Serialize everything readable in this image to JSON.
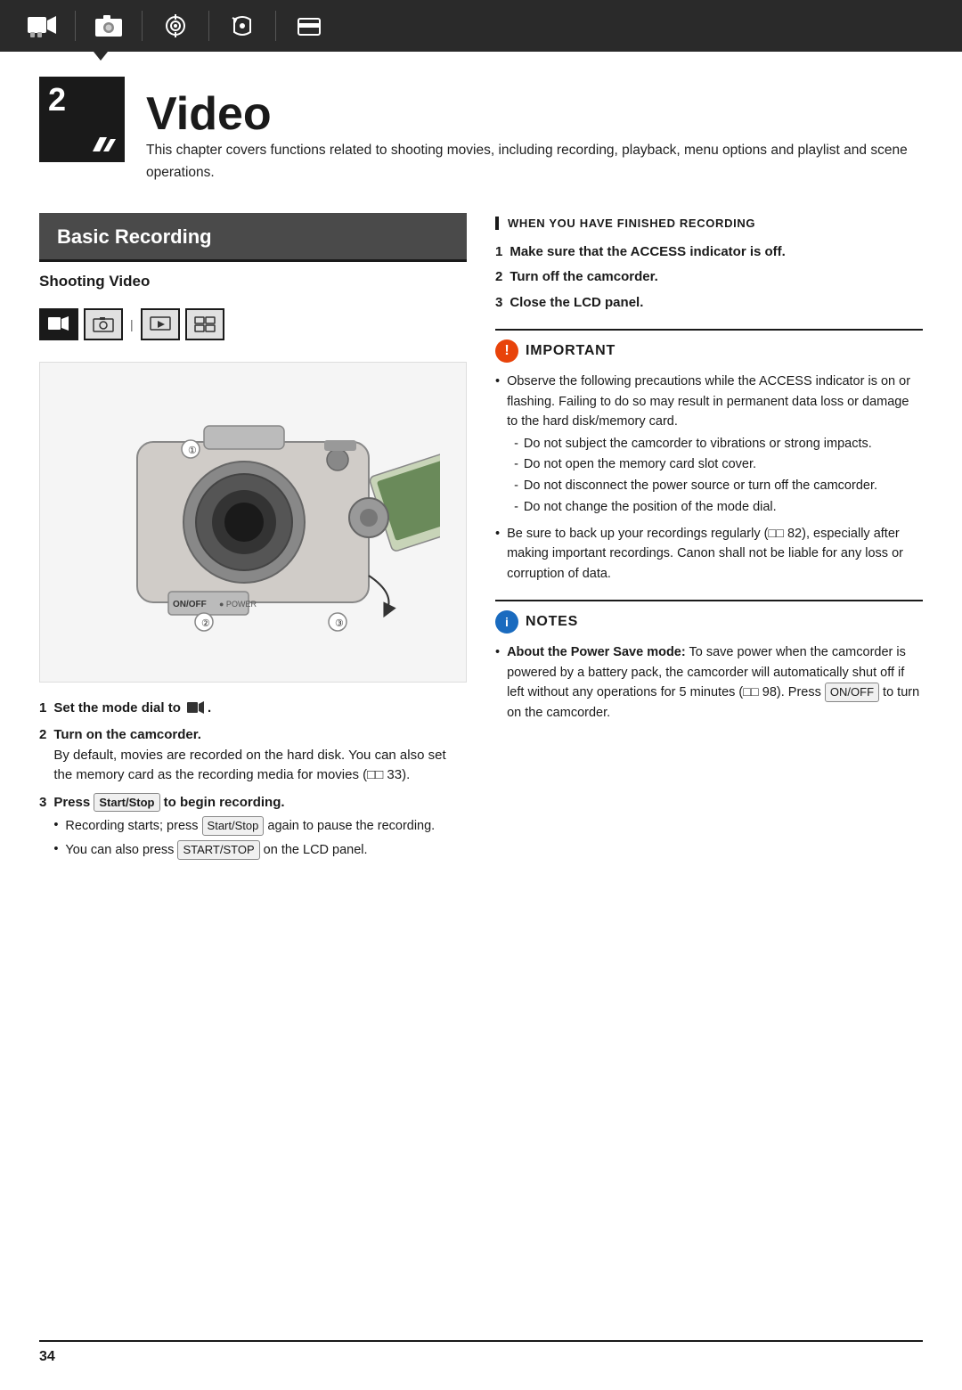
{
  "topnav": {
    "icons": [
      "video-mode-icon",
      "photo-mode-icon",
      "target-icon",
      "rotate-icon",
      "card-icon"
    ]
  },
  "chapter": {
    "number": "2",
    "title": "Video",
    "description": "This chapter covers functions related to shooting movies, including recording, playback, menu options and playlist and scene operations."
  },
  "left_col": {
    "section_title": "Basic Recording",
    "subsection": "Shooting Video",
    "steps": [
      {
        "num": "1",
        "text": "Set the mode dial to",
        "suffix": "."
      },
      {
        "num": "2",
        "bold": "Turn on the camcorder.",
        "detail": "By default, movies are recorded on the hard disk. You can also set the memory card as the recording media for movies (  33)."
      },
      {
        "num": "3",
        "bold_prefix": "Press",
        "btn": "Start/Stop",
        "bold_suffix": "to begin recording.",
        "bullets": [
          {
            "text_prefix": "Recording starts; press",
            "btn": "Start/Stop",
            "text_suffix": "again to pause the recording."
          },
          {
            "text_prefix": "You can also press",
            "btn": "START/STOP",
            "text_suffix": "on the LCD panel."
          }
        ]
      }
    ]
  },
  "right_col": {
    "when_finished_heading": "When You Have Finished Recording",
    "finished_steps": [
      {
        "num": "1",
        "text": "Make sure that the ACCESS indicator is off."
      },
      {
        "num": "2",
        "text": "Turn off the camcorder."
      },
      {
        "num": "3",
        "text": "Close the LCD panel."
      }
    ],
    "important": {
      "title": "Important",
      "bullets": [
        {
          "text": "Observe the following precautions while the ACCESS indicator is on or flashing. Failing to do so may result in permanent data loss or damage to the hard disk/memory card.",
          "sub_items": [
            "Do not subject the camcorder to vibrations or strong impacts.",
            "Do not open the memory card slot cover.",
            "Do not disconnect the power source or turn off the camcorder.",
            "Do not change the position of the mode dial."
          ]
        },
        {
          "text": "Be sure to back up your recordings regularly (  82), especially after making important recordings. Canon shall not be liable for any loss or corruption of data."
        }
      ]
    },
    "notes": {
      "title": "Notes",
      "bullets": [
        {
          "bold": "About the Power Save mode:",
          "text": " To save power when the camcorder is powered by a battery pack, the camcorder will automatically shut off if left without any operations for 5 minutes (  98). Press",
          "btn": "ON/OFF",
          "text2": " to turn on the camcorder."
        }
      ]
    }
  },
  "footer": {
    "page_number": "34"
  }
}
